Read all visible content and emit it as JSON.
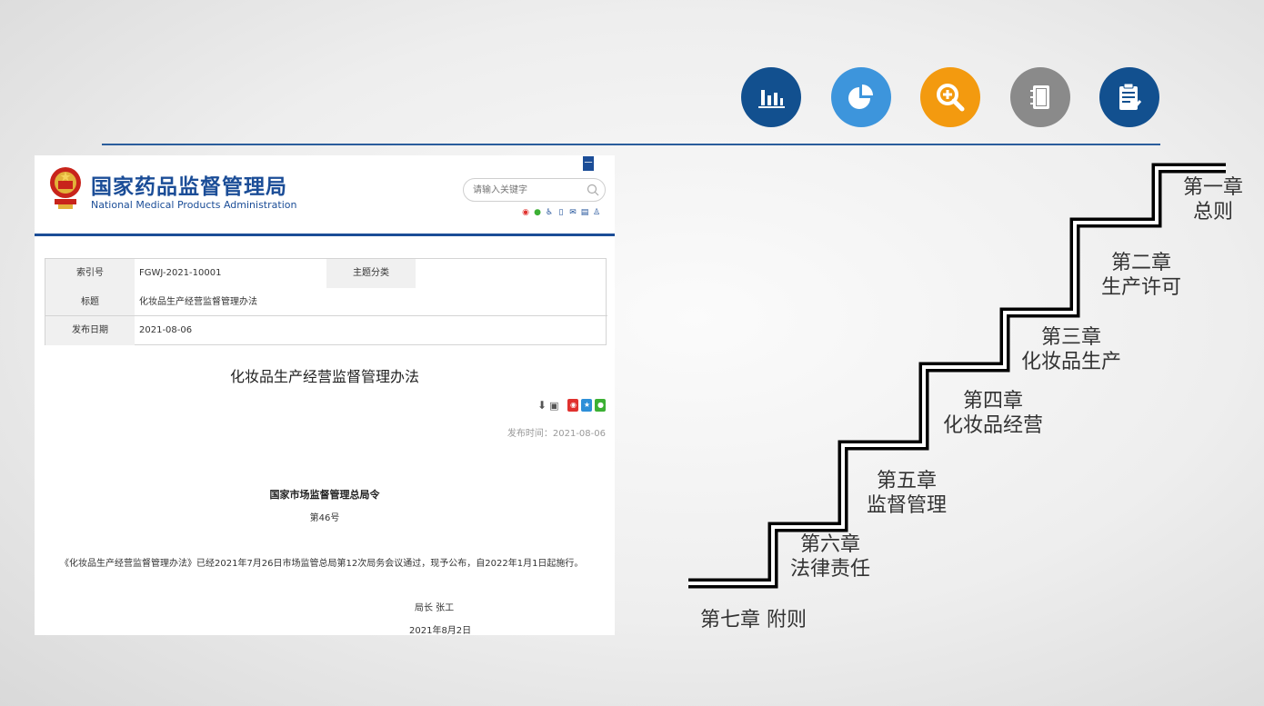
{
  "header_icons": [
    {
      "name": "bar-chart-icon",
      "color": "#12508f"
    },
    {
      "name": "pie-chart-icon",
      "color": "#3d95dc"
    },
    {
      "name": "magnify-plus-icon",
      "color": "#f39a0f"
    },
    {
      "name": "notebook-icon",
      "color": "#8a8a8a"
    },
    {
      "name": "clipboard-check-icon",
      "color": "#12508f"
    }
  ],
  "site": {
    "org_cn": "国家药品监督管理局",
    "org_en": "National Medical Products Administration",
    "search_placeholder": "请输入关键字",
    "top_button": "一"
  },
  "meta": {
    "index_label": "索引号",
    "index_value": "FGWJ-2021-10001",
    "topic_label": "主题分类",
    "topic_value": "",
    "title_label": "标题",
    "title_value": "化妆品生产经营监督管理办法",
    "date_label": "发布日期",
    "date_value": "2021-08-06"
  },
  "doc": {
    "title": "化妆品生产经营监督管理办法",
    "publish_time": "发布时间：2021-08-06",
    "order_head": "国家市场监督管理总局令",
    "order_no": "第46号",
    "body": "《化妆品生产经营监督管理办法》已经2021年7月26日市场监管总局第12次局务会议通过，现予公布，自2022年1月1日起施行。",
    "signer": "局长  张工",
    "sign_date": "2021年8月2日"
  },
  "chapters": [
    {
      "num": "第一章",
      "name": "总则"
    },
    {
      "num": "第二章",
      "name": "生产许可"
    },
    {
      "num": "第三章",
      "name": "化妆品生产"
    },
    {
      "num": "第四章",
      "name": "化妆品经营"
    },
    {
      "num": "第五章",
      "name": "监督管理"
    },
    {
      "num": "第六章",
      "name": "法律责任"
    },
    {
      "num": "第七章",
      "name": "附则"
    }
  ]
}
